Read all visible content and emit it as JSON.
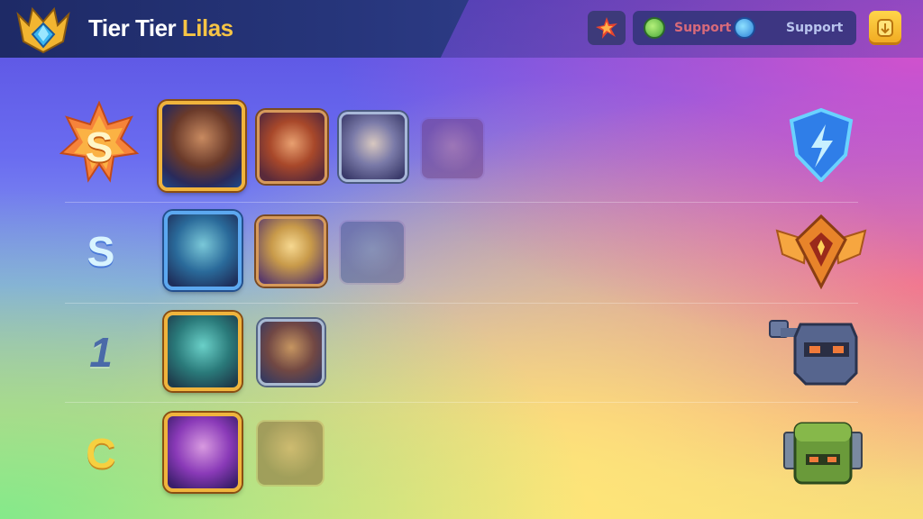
{
  "header": {
    "title_main": "Tier Tier ",
    "title_accent": "Lilas",
    "crest_icon": "crown-gem-icon",
    "alert_icon": "alert-burst-icon",
    "support_label_1": "Support",
    "support_label_2": "Support",
    "coin_icon": "coin-icon"
  },
  "tiers": [
    {
      "label": "S",
      "style": "flame-badge",
      "role_icon": "lightning-shield-icon",
      "heroes": 4
    },
    {
      "label": "S",
      "style": "plain",
      "role_icon": "winged-gem-badge-icon",
      "heroes": 3
    },
    {
      "label": "1",
      "style": "plain",
      "role_icon": "helmet-icon",
      "heroes": 2
    },
    {
      "label": "C",
      "style": "plain",
      "role_icon": "green-block-icon",
      "heroes": 2
    }
  ],
  "colors": {
    "accent_gold": "#f6c445",
    "title_plate": "#26357a",
    "frame_gold": "#f0b43c",
    "frame_blue": "#5ca8f0",
    "tier_s_plain": "#d8f4ff",
    "tier_1": "#4a6aa8",
    "tier_c": "#f6d040"
  }
}
